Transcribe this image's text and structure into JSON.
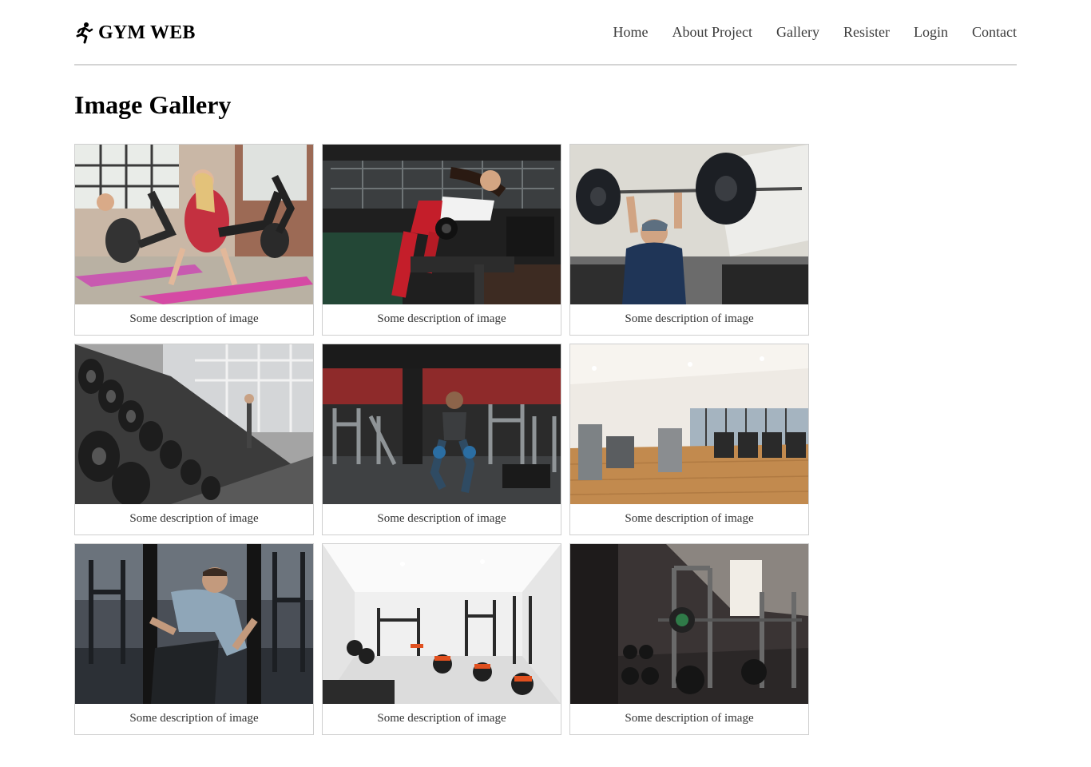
{
  "brand": {
    "name": "GYM WEB",
    "icon": "running-person-icon"
  },
  "nav": [
    {
      "label": "Home"
    },
    {
      "label": "About Project"
    },
    {
      "label": "Gallery"
    },
    {
      "label": "Resister"
    },
    {
      "label": "Login"
    },
    {
      "label": "Contact"
    }
  ],
  "page_title": "Image Gallery",
  "gallery": [
    {
      "caption": "Some description of image",
      "scene": "women-floor-exercise-photo"
    },
    {
      "caption": "Some description of image",
      "scene": "woman-dumbbell-row-photo"
    },
    {
      "caption": "Some description of image",
      "scene": "man-overhead-barbell-photo"
    },
    {
      "caption": "Some description of image",
      "scene": "dumbbell-rack-photo"
    },
    {
      "caption": "Some description of image",
      "scene": "man-lunges-gym-photo"
    },
    {
      "caption": "Some description of image",
      "scene": "empty-gym-treadmills-photo"
    },
    {
      "caption": "Some description of image",
      "scene": "man-machine-press-photo"
    },
    {
      "caption": "Some description of image",
      "scene": "white-gym-interior-photo"
    },
    {
      "caption": "Some description of image",
      "scene": "squat-rack-room-photo"
    }
  ]
}
